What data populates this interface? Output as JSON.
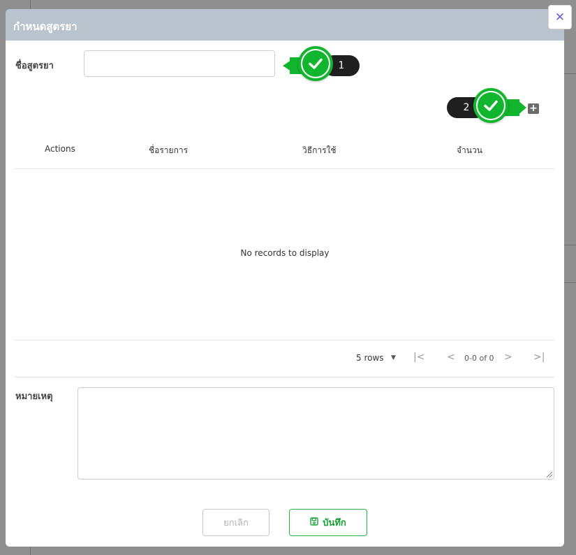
{
  "modal": {
    "title": "กำหนดสูตรยา",
    "close_glyph": "✕"
  },
  "form": {
    "name_label": "ชื่อสูตรยา",
    "name_value": "",
    "name_placeholder": "",
    "note_label": "หมายเหตุ",
    "note_value": ""
  },
  "callouts": [
    {
      "number": "1",
      "icon": "check-icon"
    },
    {
      "number": "2",
      "icon": "check-icon"
    }
  ],
  "table": {
    "add_icon": "plus-square-icon",
    "add_glyph": "+",
    "columns": [
      "Actions",
      "ชื่อรายการ",
      "วิธีการใช้",
      "จำนวน"
    ],
    "rows": [],
    "empty_message": "No records to display"
  },
  "pagination": {
    "rows_label": "5 rows",
    "range_label": "0-0 of 0",
    "first_glyph": "|<",
    "prev_glyph": "<",
    "next_glyph": ">",
    "last_glyph": ">|",
    "dropdown_glyph": "▼"
  },
  "buttons": {
    "cancel_label": "ยกเลิก",
    "save_label": "บันทึก",
    "save_icon": "floppy-disk-icon"
  },
  "colors": {
    "header_bg": "#b9c3cd",
    "accent_green": "#12b62e",
    "close_icon": "#6b5fd6"
  }
}
